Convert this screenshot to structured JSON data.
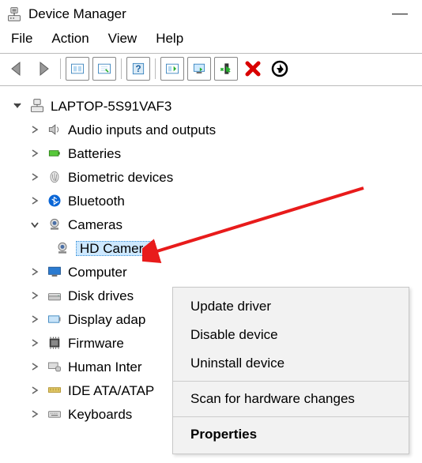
{
  "window": {
    "title": "Device Manager",
    "minimize_glyph": "—"
  },
  "menu": {
    "file": "File",
    "action": "Action",
    "view": "View",
    "help": "Help"
  },
  "toolbar": {
    "back": "back",
    "forward": "forward",
    "properties_icon": "properties",
    "scan_icon": "scan",
    "help_icon": "help",
    "update_icon": "update",
    "monitor_icon": "monitor",
    "enable_icon": "enable",
    "remove_icon": "remove",
    "refresh_icon": "refresh"
  },
  "tree": {
    "root": "LAPTOP-5S91VAF3",
    "items": [
      {
        "label": "Audio inputs and outputs"
      },
      {
        "label": "Batteries"
      },
      {
        "label": "Biometric devices"
      },
      {
        "label": "Bluetooth"
      },
      {
        "label": "Cameras",
        "expanded": true,
        "children": [
          {
            "label": "HD Camera",
            "selected": true
          }
        ]
      },
      {
        "label": "Computer"
      },
      {
        "label": "Disk drives"
      },
      {
        "label": "Display adap"
      },
      {
        "label": "Firmware"
      },
      {
        "label": "Human Inter"
      },
      {
        "label": "IDE ATA/ATAP"
      },
      {
        "label": "Keyboards"
      }
    ]
  },
  "context_menu": {
    "update": "Update driver",
    "disable": "Disable device",
    "uninstall": "Uninstall device",
    "scan": "Scan for hardware changes",
    "properties": "Properties"
  }
}
